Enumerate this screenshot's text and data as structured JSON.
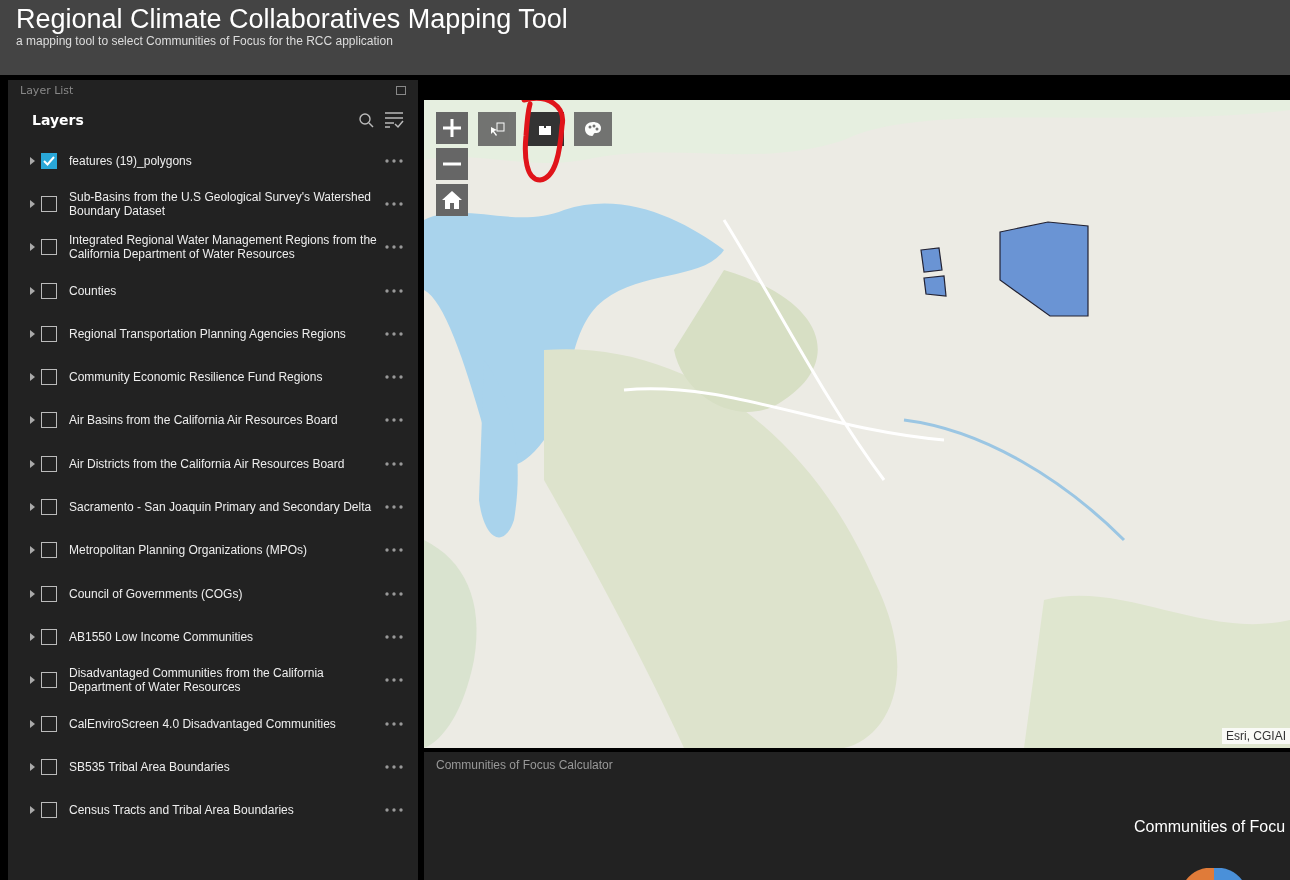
{
  "header": {
    "title": "Regional Climate Collaboratives Mapping Tool",
    "subtitle": "a mapping tool to select Communities of Focus for the RCC application"
  },
  "layer_panel": {
    "title": "Layer List",
    "heading": "Layers",
    "layers": [
      {
        "label": "features (19)_polygons",
        "checked": true
      },
      {
        "label": "Sub-Basins from the U.S Geological Survey's Watershed Boundary Dataset",
        "checked": false
      },
      {
        "label": "Integrated Regional Water Management Regions from the California Department of Water Resources",
        "checked": false
      },
      {
        "label": "Counties",
        "checked": false
      },
      {
        "label": "Regional Transportation Planning Agencies Regions",
        "checked": false
      },
      {
        "label": "Community Economic Resilience Fund Regions",
        "checked": false
      },
      {
        "label": "Air Basins from the California Air Resources Board",
        "checked": false
      },
      {
        "label": "Air Districts from the California Air Resources Board",
        "checked": false
      },
      {
        "label": "Sacramento - San Joaquin Primary and Secondary Delta",
        "checked": false
      },
      {
        "label": "Metropolitan Planning Organizations (MPOs)",
        "checked": false
      },
      {
        "label": "Council of Governments (COGs)",
        "checked": false
      },
      {
        "label": "AB1550 Low Income Communities",
        "checked": false
      },
      {
        "label": "Disadvantaged Communities from the California Department of Water Resources",
        "checked": false
      },
      {
        "label": "CalEnviroScreen 4.0 Disadvantaged Communities",
        "checked": false
      },
      {
        "label": "SB535 Tribal Area Boundaries",
        "checked": false
      },
      {
        "label": "Census Tracts and Tribal Area Boundaries",
        "checked": false
      }
    ]
  },
  "map": {
    "kind": "picture",
    "attribution": "Esri, CGIAI",
    "tools": [
      {
        "kind": "select",
        "selected": false
      },
      {
        "kind": "add-data",
        "selected": true
      },
      {
        "kind": "palette",
        "selected": false
      }
    ]
  },
  "calculator": {
    "title": "Communities of Focus Calculator",
    "chart_title": "Communities of Focu"
  }
}
